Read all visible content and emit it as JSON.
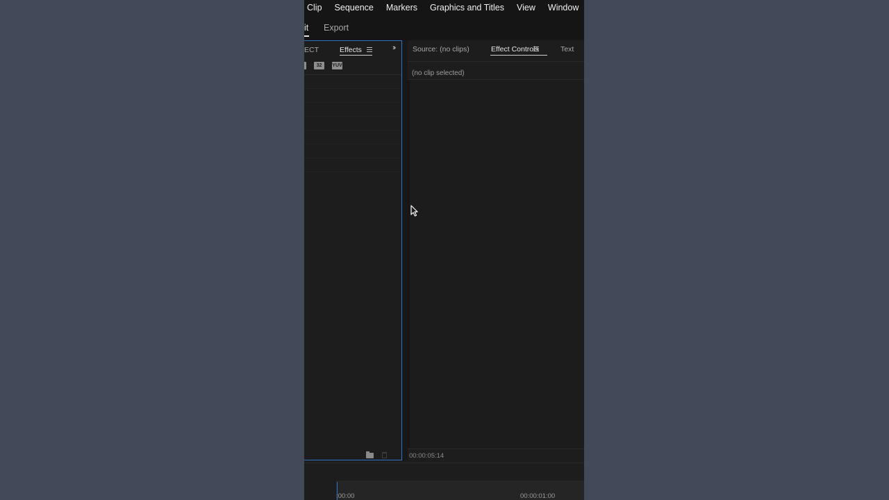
{
  "menubar": {
    "items": [
      "Clip",
      "Sequence",
      "Markers",
      "Graphics and Titles",
      "View",
      "Window"
    ]
  },
  "workspace": {
    "edit_tab": "it",
    "export_tab": "Export"
  },
  "left_panel": {
    "tab_partial": "ECT",
    "tab_effects": "Effects",
    "icon_32": "32",
    "icon_yuv": "YUV",
    "icons": [
      "menu-icon",
      "chevrons-icon",
      "accelerated-effects-icon",
      "32-bit-icon",
      "yuv-icon",
      "folder-icon",
      "trash-icon"
    ]
  },
  "right_panel": {
    "tab_source": "Source: (no clips)",
    "tab_effect_controls": "Effect Controls",
    "tab_text": "Text",
    "no_clip": "(no clip selected)",
    "timecode": "00:00:05:14"
  },
  "timeline": {
    "time_start": ":00:00",
    "time_next": "00:00:01:00"
  },
  "colors": {
    "focus_border": "#2d73c9",
    "background_outer": "#434959",
    "panel_bg": "#1d1d1d"
  }
}
